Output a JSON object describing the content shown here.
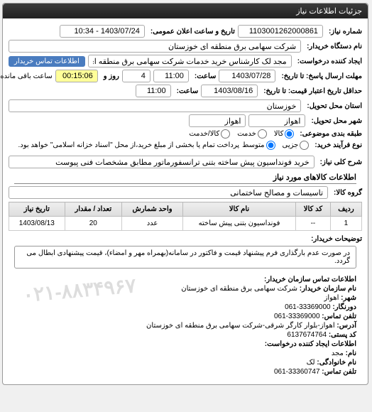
{
  "panel": {
    "title": "جزئیات اطلاعات نیاز"
  },
  "fields": {
    "need_no_label": "شماره نیاز:",
    "need_no": "1103001262000861",
    "announce_label": "تاریخ و ساعت اعلان عمومی:",
    "announce_value": "1403/07/24 - 10:34",
    "buyer_org_label": "نام دستگاه خریدار:",
    "buyer_org": "شرکت سهامی برق منطقه ای خوزستان",
    "creator_label": "ایجاد کننده درخواست:",
    "creator": "مجد لک کارشناس خرید خدمات شرکت سهامی برق منطقه ای خوزستان",
    "buyer_contact_link": "اطلاعات تماس خریدار",
    "deadline_reply_label": "مهلت ارسال پاسخ: تا تاریخ:",
    "deadline_reply_date": "1403/07/28",
    "time_label_1": "ساعت:",
    "deadline_reply_time": "11:00",
    "and_label": "و",
    "days_left": "4",
    "remain_label": "روز و",
    "remain_time": "00:15:06",
    "remain_suffix": "ساعت باقی مانده",
    "validity_label": "حداقل تاریخ اعتبار قیمت: تا تاریخ:",
    "validity_date": "1403/08/16",
    "time_label_2": "ساعت:",
    "validity_time": "11:00",
    "delivery_state_label": "استان محل تحویل:",
    "delivery_state": "خوزستان",
    "delivery_city_label": "شهر محل تحویل:",
    "delivery_city": "اهواز",
    "city2": "اهواز",
    "subject_class_label": "طبقه بندی موضوعی:",
    "radio_goods": "کالا",
    "radio_service": "خدمت",
    "radio_goods_service": "کالا/خدمت",
    "process_label": "نوع فرآیند خرید:",
    "radio_partial": "جزیی",
    "radio_medium": "متوسط",
    "process_note": "پرداخت تمام یا بخشی از مبلغ خرید،از محل \"اسناد خزانه اسلامی\" خواهد بود."
  },
  "need": {
    "main_desc_label": "شرح کلی نیاز:",
    "main_desc": "خرید فونداسیون پیش ساخته بتنی ترانسفورماتور مطابق مشخصات فنی پیوست"
  },
  "goods_section_title": "اطلاعات کالاهای مورد نیاز",
  "goods_group_label": "گروه کالا:",
  "goods_group": "تاسیسات و مصالح ساختمانی",
  "table": {
    "headers": {
      "row": "ردیف",
      "code": "کد کالا",
      "name": "نام کالا",
      "unit": "واحد شمارش",
      "qty": "تعداد / مقدار",
      "date": "تاریخ نیاز"
    },
    "rows": [
      {
        "row": "1",
        "code": "--",
        "name": "فونداسیون بتنی پیش ساخته",
        "unit": "عدد",
        "qty": "20",
        "date": "1403/08/13"
      }
    ]
  },
  "explain_label": "توضیحات خریدار:",
  "explain_text": "در صورت عدم بارگذاری فرم پیشنهاد قیمت و فاکتور در سامانه(بهمراه مهر و امضاء)، قیمت پیشنهادی ابطال می گردد.",
  "contact": {
    "section_title": "اطلاعات تماس سازمان خریدار:",
    "org_label": "نام سازمان خریدار:",
    "org": "شرکت سهامی برق منطقه ای خوزستان",
    "city_label": "شهر:",
    "city": "اهواز",
    "phone_label": "دورنگار:",
    "phone": "33369000-061",
    "fax_label": "تلفن تماس:",
    "fax": "33369000-061",
    "address_label": "آدرس:",
    "address": "اهواز-بلوار کارگر شرقی-شرکت سهامی برق منطقه ای خوزستان",
    "postal_label": "کد پستی:",
    "postal": "6137674764",
    "creator_section": "اطلاعات ایجاد کننده درخواست:",
    "name_label": "نام:",
    "name": "مجد",
    "family_label": "نام خانوادگی:",
    "family": "لک",
    "contact_phone_label": "تلفن تماس:",
    "contact_phone": "33360747-061"
  },
  "watermark": "۰۲۱-۸۸۳۴۹۶۷"
}
